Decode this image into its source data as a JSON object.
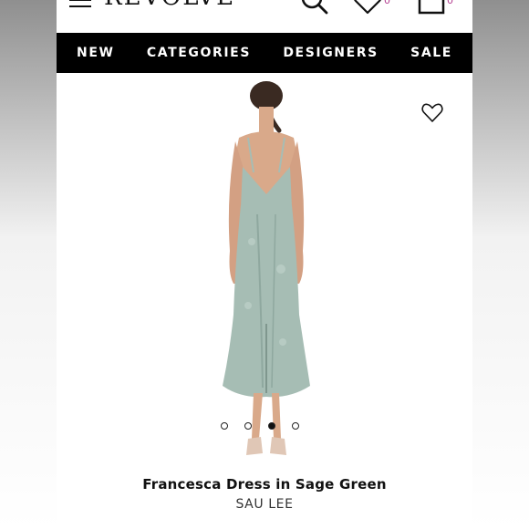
{
  "header": {
    "logo": "REVOLVE",
    "wishlist_count": "0",
    "bag_count": "0"
  },
  "nav": [
    "NEW",
    "CATEGORIES",
    "DESIGNERS",
    "SALE"
  ],
  "product": {
    "title": "Francesca Dress in Sage Green",
    "brand": "SAU LEE",
    "gallery": {
      "image_count": 4,
      "active_index": 2
    }
  },
  "colors": {
    "nav_background": "#000000",
    "nav_text": "#ffffff",
    "badge": "#b33c8f",
    "dress": "#a6bdb4"
  },
  "icons": [
    "menu-icon",
    "search-icon",
    "heart-icon",
    "shopping-bag-icon",
    "wishlist-heart-icon"
  ]
}
